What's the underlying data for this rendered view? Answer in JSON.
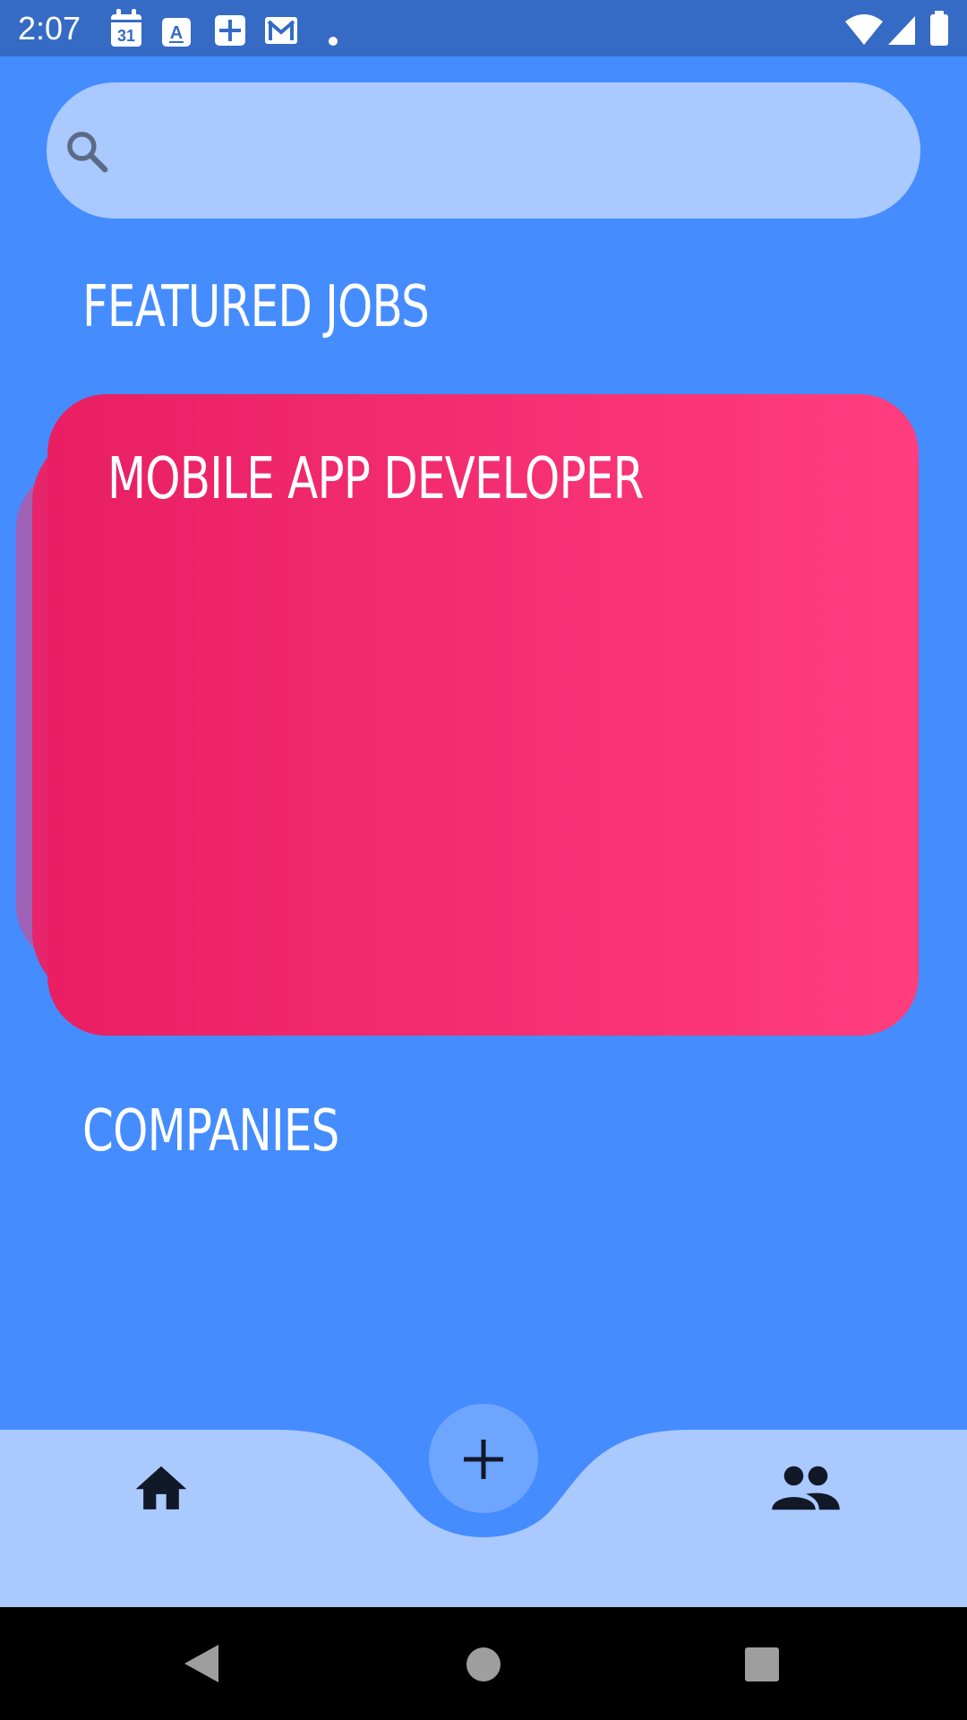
{
  "status_bar": {
    "time": "2:07",
    "calendar_day": "31",
    "icons": [
      "calendar-icon",
      "translate-icon",
      "add-box-icon",
      "gmail-icon",
      "dot-icon",
      "wifi-icon",
      "signal-icon",
      "battery-icon"
    ]
  },
  "search": {
    "placeholder": "",
    "value": "",
    "icon": "search-icon"
  },
  "sections": {
    "featured_title": "FEATURED JOBS",
    "companies_title": "COMPANIES"
  },
  "featured_jobs": [
    {
      "title": "MOBILE APP DEVELOPER"
    }
  ],
  "bottom_nav": {
    "items": [
      "home-icon",
      "add-icon",
      "people-icon"
    ]
  },
  "colors": {
    "background": "#458cff",
    "status_bar": "#356bc5",
    "search_bar": "#aac9ff",
    "card_start": "#e91e63",
    "card_end": "#ff3d7f",
    "nav_bar": "#aac9ff",
    "fab": "#6ea5ff"
  }
}
